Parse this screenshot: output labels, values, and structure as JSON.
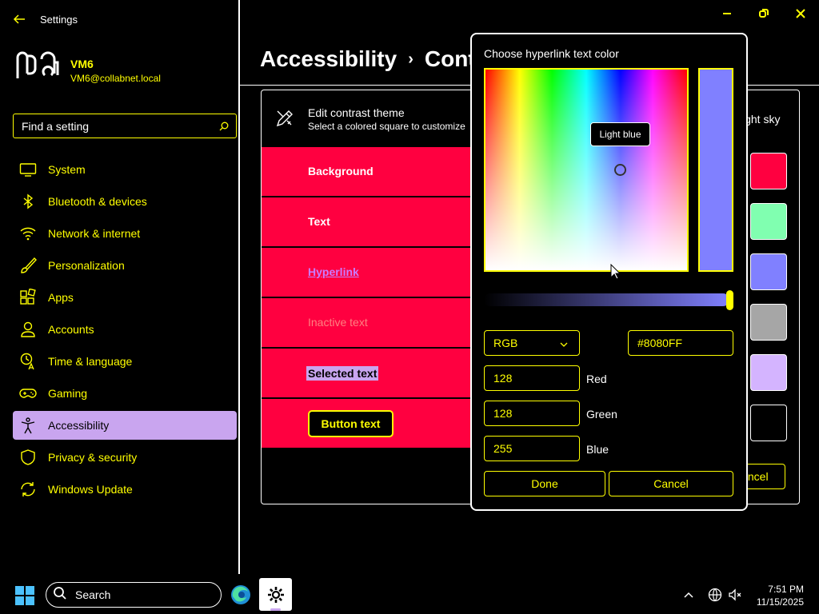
{
  "app": {
    "title": "Settings"
  },
  "user": {
    "name": "VM6",
    "email": "VM6@collabnet.local"
  },
  "search": {
    "placeholder": "Find a setting"
  },
  "sidebar": {
    "items": [
      {
        "label": "System",
        "icon": "monitor-icon"
      },
      {
        "label": "Bluetooth & devices",
        "icon": "bluetooth-icon"
      },
      {
        "label": "Network & internet",
        "icon": "wifi-icon"
      },
      {
        "label": "Personalization",
        "icon": "brush-icon"
      },
      {
        "label": "Apps",
        "icon": "apps-icon"
      },
      {
        "label": "Accounts",
        "icon": "person-icon"
      },
      {
        "label": "Time & language",
        "icon": "clock-globe-icon"
      },
      {
        "label": "Gaming",
        "icon": "gamepad-icon"
      },
      {
        "label": "Accessibility",
        "icon": "accessibility-icon",
        "active": true
      },
      {
        "label": "Privacy & security",
        "icon": "shield-icon"
      },
      {
        "label": "Windows Update",
        "icon": "sync-icon"
      }
    ]
  },
  "breadcrumb": {
    "parent": "Accessibility",
    "separator": "›",
    "current": "Contrast themes"
  },
  "panel": {
    "title": "Edit contrast theme",
    "subtitle": "Select a colored square to customize",
    "theme_name_visible": "ight sky",
    "cancel_label": "Cancel",
    "rows": [
      {
        "label": "Background",
        "swatch": "#ff0040"
      },
      {
        "label": "Text",
        "swatch": "#80ffb0"
      },
      {
        "label": "Hyperlink",
        "swatch": "#8080ff"
      },
      {
        "label": "Inactive text",
        "swatch": "#a6a6a6"
      },
      {
        "label": "Selected text",
        "swatch": "#d4b4ff"
      },
      {
        "label": "Button text",
        "swatch": "#000000"
      }
    ]
  },
  "dialog": {
    "title": "Choose hyperlink text color",
    "tooltip": "Light blue",
    "mode": "RGB",
    "hex": "#8080FF",
    "preview_color": "#8080ff",
    "red": {
      "value": "128",
      "label": "Red"
    },
    "green": {
      "value": "128",
      "label": "Green"
    },
    "blue": {
      "value": "255",
      "label": "Blue"
    },
    "done_label": "Done",
    "cancel_label": "Cancel"
  },
  "taskbar": {
    "search_label": "Search",
    "time": "7:51 PM",
    "date": "11/15/2025"
  },
  "colors": {
    "accent_yellow": "#ffff00",
    "row_red": "#ff0040",
    "selection_purple": "#c9a5ef",
    "hyperlink_purple": "#c97cff"
  }
}
